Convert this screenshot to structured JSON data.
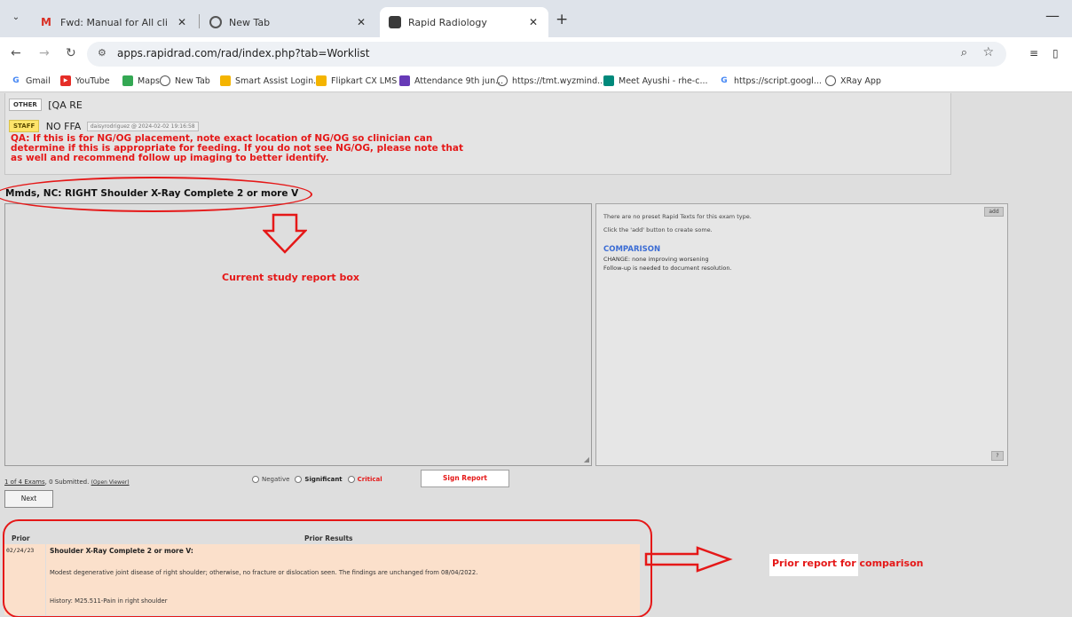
{
  "browser": {
    "tabs": [
      {
        "title": "Fwd: Manual for All clients - sh",
        "icon": "gmail-icon"
      },
      {
        "title": "New Tab",
        "icon": "chrome-icon"
      },
      {
        "title": "Rapid Radiology",
        "icon": "app-icon"
      }
    ],
    "url": "apps.rapidrad.com/rad/index.php?tab=Worklist",
    "bookmarks": [
      "Gmail",
      "YouTube",
      "Maps",
      "New Tab",
      "Smart Assist Login...",
      "Flipkart CX LMS",
      "Attendance 9th jun...",
      "https://tmt.wyzmind...",
      "Meet Ayushi - rhe-c...",
      "https://script.googl...",
      "XRay App"
    ]
  },
  "notes": {
    "other_tag": "OTHER",
    "other_value": "[QA RE",
    "staff_tag": "STAFF",
    "staff_value": "NO FFA",
    "staff_meta": "daisyrodriguez @ 2024-02-02 19:16:58",
    "qa_text": "QA: If this is for NG/OG placement, note exact location of NG/OG so clinician can determine if this is appropriate for feeding. If you do not see NG/OG, please note that as well and recommend follow up imaging to better identify."
  },
  "exam": {
    "title": "Mmds, NC: RIGHT Shoulder X-Ray Complete 2 or more V"
  },
  "rapid_texts": {
    "add_label": "add",
    "line1": "There are no preset Rapid Texts for this exam type.",
    "line2": "Click the 'add' button to create some.",
    "comparison_heading": "COMPARISON",
    "change_line": "CHANGE: none  improving  worsening",
    "followup_line": "Follow-up is needed to document resolution.",
    "help_label": "?"
  },
  "status": {
    "exams": "1 of 4 Exams",
    "submitted": ", 0 Submitted.",
    "open_viewer": "(Open Viewer)"
  },
  "radios": {
    "negative": "Negative",
    "significant": "Significant",
    "critical": "Critical"
  },
  "buttons": {
    "sign_report": "Sign Report",
    "next": "Next"
  },
  "prior": {
    "col_prior": "Prior",
    "col_results": "Prior Results",
    "date": "02/24/23",
    "study": "Shoulder X-Ray Complete 2 or more V:",
    "finding": "Modest degenerative joint disease of right shoulder; otherwise, no fracture or dislocation seen. The findings are unchanged from 08/04/2022.",
    "history": "History: M25.511-Pain in right shoulder"
  },
  "annotations": {
    "report_box_label": "Current study report box",
    "prior_label": "Prior report for comparison",
    "color": "#e51818"
  }
}
